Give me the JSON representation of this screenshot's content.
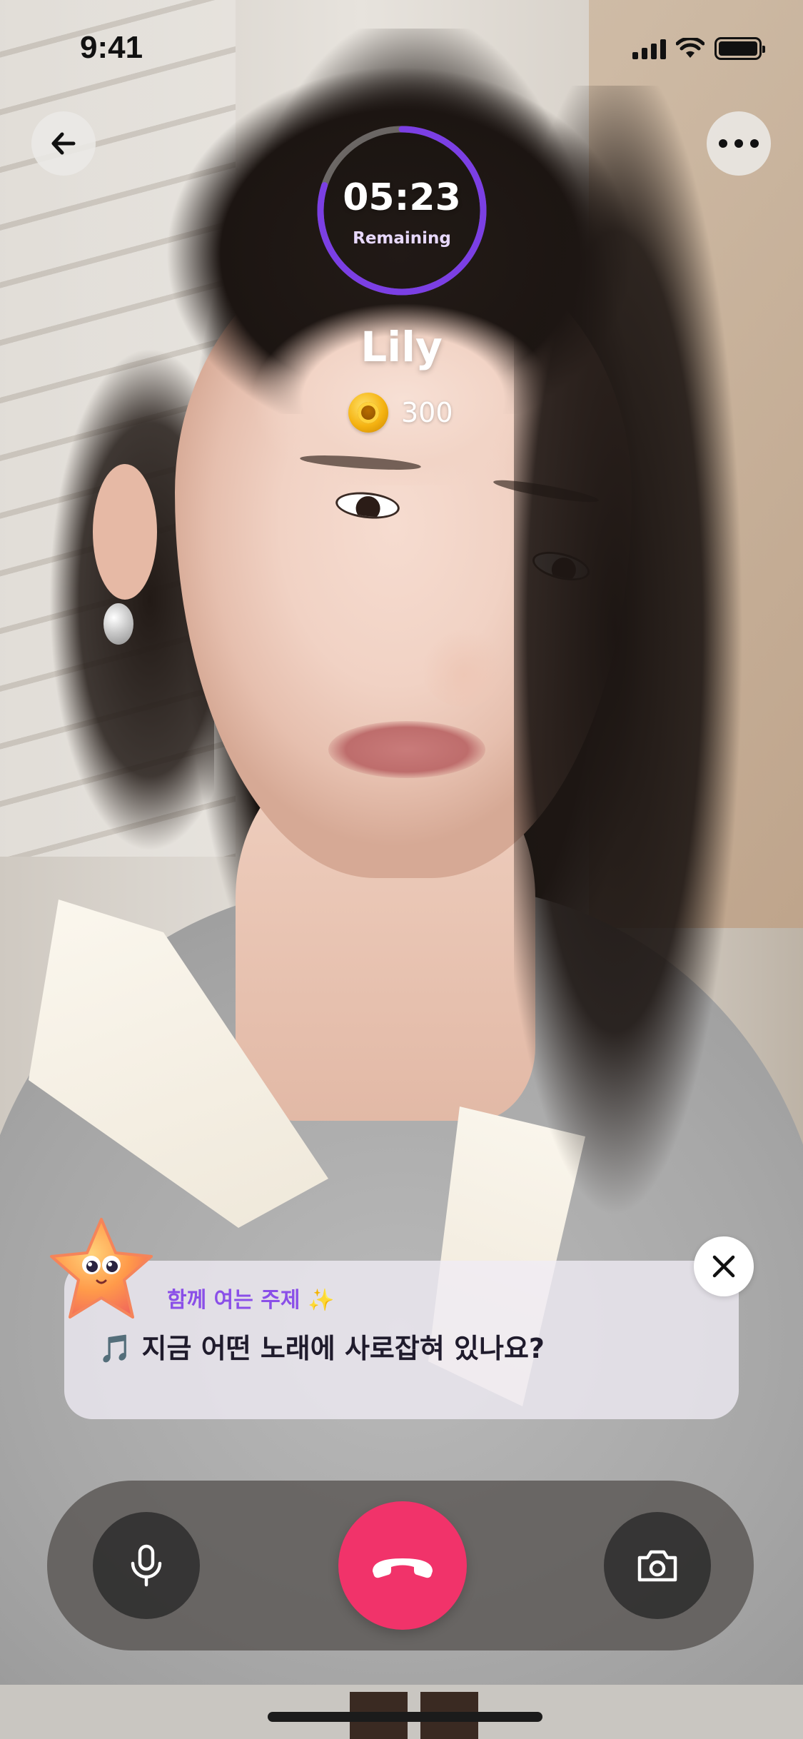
{
  "status_bar": {
    "time": "9:41",
    "icons": [
      "signal-icon",
      "wifi-icon",
      "battery-icon"
    ]
  },
  "header": {
    "back_icon": "arrow-left-icon",
    "more_icon": "more-horizontal-icon"
  },
  "timer": {
    "value": "05:23",
    "label": "Remaining",
    "progress": 0.8,
    "ring_color": "#7b3fe4"
  },
  "caller": {
    "name": "Lily",
    "coin_icon": "coin-icon",
    "coins": "300"
  },
  "topic": {
    "title": "함께 여는 주제",
    "sparkle": "✨",
    "question": "🎵 지금 어떤 노래에 사로잡혀 있나요?",
    "mascot_icon": "star-mascot-icon",
    "close_icon": "close-icon"
  },
  "controls": {
    "mic_icon": "microphone-icon",
    "end_call_icon": "phone-hangup-icon",
    "camera_icon": "camera-icon",
    "end_call_color": "#f1336a"
  }
}
